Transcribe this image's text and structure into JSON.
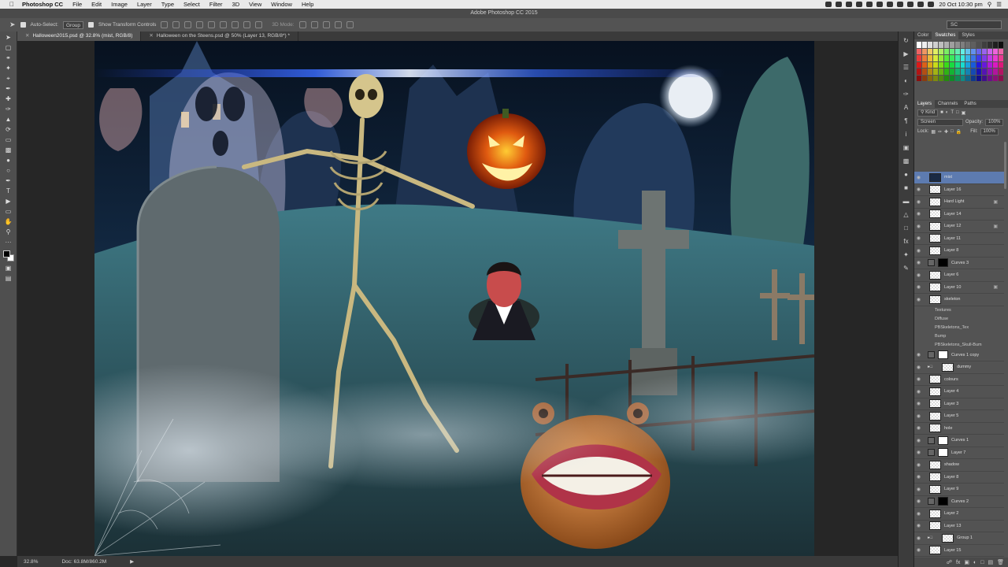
{
  "menubar": {
    "app": "Photoshop CC",
    "items": [
      "File",
      "Edit",
      "Image",
      "Layer",
      "Type",
      "Select",
      "Filter",
      "3D",
      "View",
      "Window",
      "Help"
    ],
    "datetime": "20 Oct 10:30 pm"
  },
  "window": {
    "title": "Adobe Photoshop CC 2015"
  },
  "options": {
    "auto_select_label": "Auto-Select:",
    "auto_select_value": "Group",
    "transform_label": "Show Transform Controls",
    "mode_3d": "3D Mode:",
    "workspace": "SC"
  },
  "tabs": [
    {
      "label": "Halloween2015.psd @ 32.8% (mist, RGB/8)",
      "active": true
    },
    {
      "label": "Halloween on the Steens.psd @ 50% (Layer 13, RGB/8*) *",
      "active": false
    }
  ],
  "status": {
    "zoom": "32.8%",
    "doc": "Doc: 63.8M/860.2M"
  },
  "swatch_panel": {
    "tabs": [
      "Color",
      "Swatches",
      "Styles"
    ],
    "active": "Swatches"
  },
  "layers_panel": {
    "tabs": [
      "Layers",
      "Channels",
      "Paths"
    ],
    "active": "Layers",
    "filter_kind": "Kind",
    "blend_mode": "Screen",
    "opacity_label": "Opacity:",
    "opacity": "100%",
    "lock_label": "Lock:",
    "fill_label": "Fill:",
    "fill": "100%",
    "layers": [
      {
        "name": "mist",
        "type": "dark",
        "active": true
      },
      {
        "name": "Layer 16",
        "type": "pixel"
      },
      {
        "name": "Hard Light",
        "type": "pixel",
        "locked": true
      },
      {
        "name": "Layer 14",
        "type": "pixel"
      },
      {
        "name": "Layer 12",
        "type": "pixel",
        "locked": true
      },
      {
        "name": "Layer 11",
        "type": "pixel"
      },
      {
        "name": "Layer 8",
        "type": "pixel"
      },
      {
        "name": "Curves 3",
        "type": "adj-dark"
      },
      {
        "name": "Layer 6",
        "type": "pixel"
      },
      {
        "name": "Layer 10",
        "type": "pixel",
        "locked": true
      },
      {
        "name": "skeleton",
        "type": "pixel"
      },
      {
        "name": "Textures",
        "type": "sub"
      },
      {
        "name": "Diffuse",
        "type": "sub"
      },
      {
        "name": "PBSkeletons_Tex",
        "type": "sub"
      },
      {
        "name": "Bump",
        "type": "sub"
      },
      {
        "name": "PBSkeletons_Skull-Bum",
        "type": "sub"
      },
      {
        "name": "Curves 1 copy",
        "type": "adj"
      },
      {
        "name": "dummy",
        "type": "group"
      },
      {
        "name": "colours",
        "type": "pixel"
      },
      {
        "name": "Layer 4",
        "type": "pixel"
      },
      {
        "name": "Layer 3",
        "type": "pixel"
      },
      {
        "name": "Layer 5",
        "type": "pixel"
      },
      {
        "name": "hole",
        "type": "pixel"
      },
      {
        "name": "Curves 1",
        "type": "adj"
      },
      {
        "name": "Layer 7",
        "type": "adj"
      },
      {
        "name": "shadow",
        "type": "pixel"
      },
      {
        "name": "Layer 8",
        "type": "pixel"
      },
      {
        "name": "Layer 9",
        "type": "pixel"
      },
      {
        "name": "Curves 2",
        "type": "adj-dark"
      },
      {
        "name": "Layer 2",
        "type": "pixel"
      },
      {
        "name": "Layer 13",
        "type": "pixel"
      },
      {
        "name": "Group 1",
        "type": "group"
      },
      {
        "name": "Layer 15",
        "type": "pixel"
      },
      {
        "name": "Layer 1",
        "type": "pixel"
      }
    ]
  },
  "colors": {
    "accent": "#5d7bb0",
    "panel": "#535353",
    "menubar": "#e9e9e9"
  }
}
